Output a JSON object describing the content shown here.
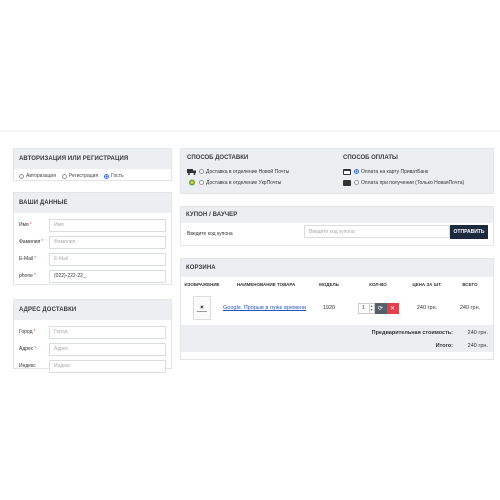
{
  "auth": {
    "title": "Авторизация или регистрация",
    "options": [
      {
        "label": "Авторизация",
        "selected": false
      },
      {
        "label": "Регистрация",
        "selected": false
      },
      {
        "label": "Гость",
        "selected": true
      }
    ]
  },
  "personal": {
    "title": "Ваши данные",
    "fields": [
      {
        "label": "Имя",
        "required": "*",
        "value": "",
        "placeholder": "Имя"
      },
      {
        "label": "Фамилия",
        "required": "*",
        "value": "",
        "placeholder": "Фамилия"
      },
      {
        "label": "E-Mail",
        "required": "*",
        "value": "",
        "placeholder": "E-Mail"
      },
      {
        "label": "phone",
        "required": "*",
        "value": "(022)-222-22_",
        "placeholder": ""
      }
    ]
  },
  "address": {
    "title": "Адрес доставки",
    "fields": [
      {
        "label": "Город",
        "required": "*",
        "placeholder": "Город"
      },
      {
        "label": "Адрес",
        "required": "*",
        "placeholder": "Адрес"
      },
      {
        "label": "Индекс",
        "required": "",
        "placeholder": "Индекс"
      }
    ]
  },
  "shipping": {
    "title": "Способ доставки",
    "options": [
      {
        "label": "Доставка в отделение Новой Почты",
        "icon": "truck-icon",
        "selected": false
      },
      {
        "label": "Доставка в отделение УкрПочты",
        "icon": "ukrposhta-icon",
        "selected": false
      }
    ]
  },
  "payment": {
    "title": "Способ оплаты",
    "options": [
      {
        "label": "Оплата на карту ПриватБанк",
        "icon": "card-icon",
        "selected": true
      },
      {
        "label": "Оплата при получении (Только НоваяПочта)",
        "icon": "cash-icon",
        "selected": false
      }
    ]
  },
  "coupon": {
    "title": "Купон / Ваучер",
    "label": "Введите код купона",
    "placeholder": "Введите код купона",
    "button": "Отправить"
  },
  "cart": {
    "title": "Корзина",
    "headers": {
      "image": "Изображение",
      "name": "Наименование товара",
      "model": "Модель",
      "qty": "Кол-во",
      "price": "Цена за шт.",
      "total": "Всего"
    },
    "items": [
      {
        "name": "Google. Прорыв в луже времени",
        "model": "1920",
        "qty": "1",
        "price": "240 грн.",
        "total": "240 грн."
      }
    ],
    "subtotal_label": "Предварительная стоимость:",
    "subtotal_value": "240 грн.",
    "total_label": "Итого:",
    "total_value": "240 грн."
  },
  "colors": {
    "accent": "#3c6ed6",
    "button_dark": "#1c2a3e",
    "delete_red": "#e0424d",
    "link": "#2a55c0"
  }
}
